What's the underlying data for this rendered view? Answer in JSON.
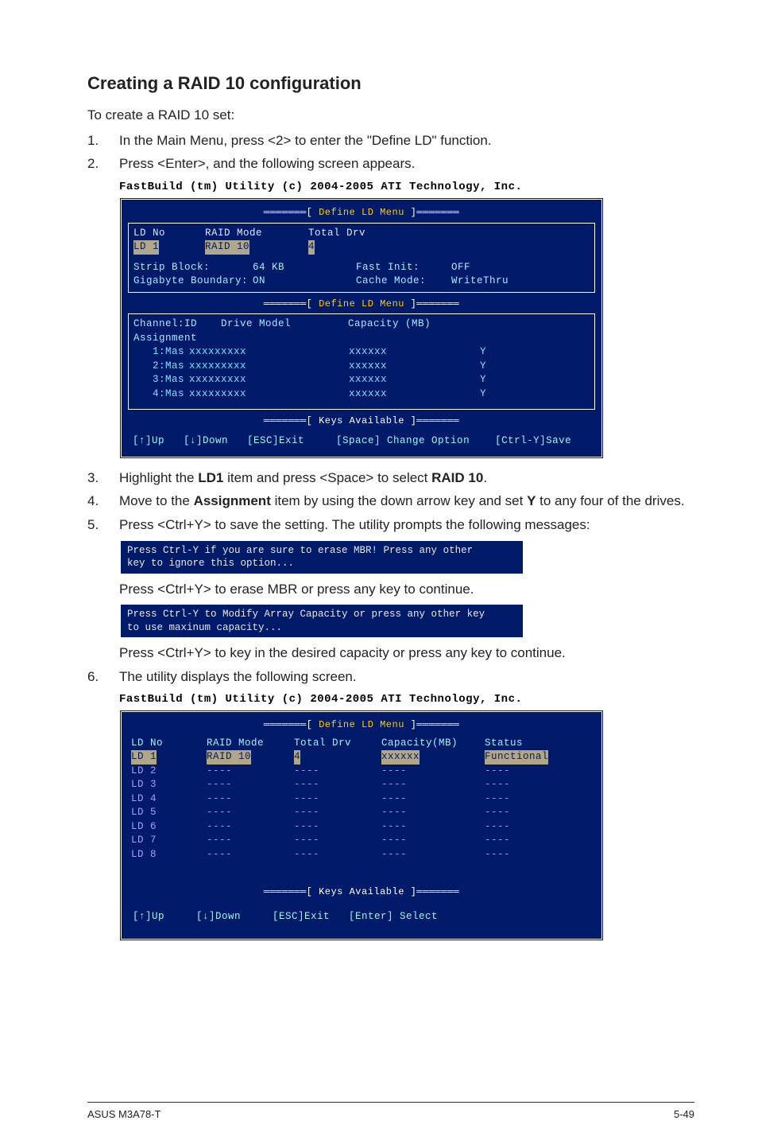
{
  "heading": "Creating a RAID 10 configuration",
  "intro": "To create a RAID 10 set:",
  "step1": "In the Main Menu, press <2> to enter the \"Define LD\" function.",
  "step2": "Press <Enter>, and the following screen appears.",
  "step3_a": "Highlight the ",
  "step3_b": "LD1",
  "step3_c": " item and press <Space> to select ",
  "step3_d": "RAID 10",
  "step3_e": ".",
  "step4_a": "Move to the ",
  "step4_b": "Assignment",
  "step4_c": " item by using the down arrow key and set ",
  "step4_d": "Y",
  "step4_e": " to any four of the drives.",
  "step5": "Press <Ctrl+Y> to save the setting. The utility prompts the following messages:",
  "step5_after1": "Press <Ctrl+Y> to erase MBR or press any key to continue.",
  "step5_after2": "Press <Ctrl+Y> to key in the desired capacity or press any key to continue.",
  "step6": "The utility displays the following screen.",
  "fb": {
    "title": "FastBuild (tm) Utility (c) 2004-2005 ATI Technology, Inc.",
    "define_menu": "Define LD Menu",
    "keys_avail": "Keys Available",
    "hdr1": {
      "ldno": "LD No",
      "mode": "RAID Mode",
      "total": "Total Drv"
    },
    "sel": {
      "ld": "LD 1",
      "mode": "RAID 10",
      "total": "4"
    },
    "strip_l": "Strip Block:",
    "strip_v": "64 KB",
    "fast_l": "Fast Init:",
    "fast_v": "OFF",
    "gig_l": "Gigabyte Boundary:",
    "gig_v": "ON",
    "cache_l": "Cache Mode:",
    "cache_v": "WriteThru",
    "hdr2": {
      "ch": "Channel:ID",
      "dm": "Drive Model",
      "cap": "Capacity (MB)",
      "as": "Assignment"
    },
    "drives": [
      {
        "ch": "1:Mas",
        "model": "xxxxxxxxx",
        "cap": "xxxxxx",
        "as": "Y"
      },
      {
        "ch": "2:Mas",
        "model": "xxxxxxxxx",
        "cap": "xxxxxx",
        "as": "Y"
      },
      {
        "ch": "3:Mas",
        "model": "xxxxxxxxx",
        "cap": "xxxxxx",
        "as": "Y"
      },
      {
        "ch": "4:Mas",
        "model": "xxxxxxxxx",
        "cap": "xxxxxx",
        "as": "Y"
      }
    ],
    "keys1": "[↑]Up   [↓]Down   [ESC]Exit     [Space] Change Option    [Ctrl-Y]Save"
  },
  "prompt1": "Press Ctrl-Y if you are sure to erase MBR! Press any other\nkey to ignore this option...",
  "prompt2": "Press Ctrl-Y to Modify Array Capacity or press any other key\nto use maxinum capacity...",
  "fb2": {
    "hdr": {
      "no": "LD No",
      "mode": "RAID Mode",
      "tot": "Total Drv",
      "cap": "Capacity(MB)",
      "st": "Status"
    },
    "sel": {
      "no": "LD 1",
      "mode": "RAID 10",
      "tot": "4",
      "cap": "xxxxxx",
      "st": "Functional"
    },
    "rows": [
      "LD 2",
      "LD 3",
      "LD 4",
      "LD 5",
      "LD 6",
      "LD 7",
      "LD 8"
    ],
    "dash": "----",
    "keys": "[↑]Up     [↓]Down     [ESC]Exit   [Enter] Select"
  },
  "footer_left": "ASUS M3A78-T",
  "footer_right": "5-49"
}
